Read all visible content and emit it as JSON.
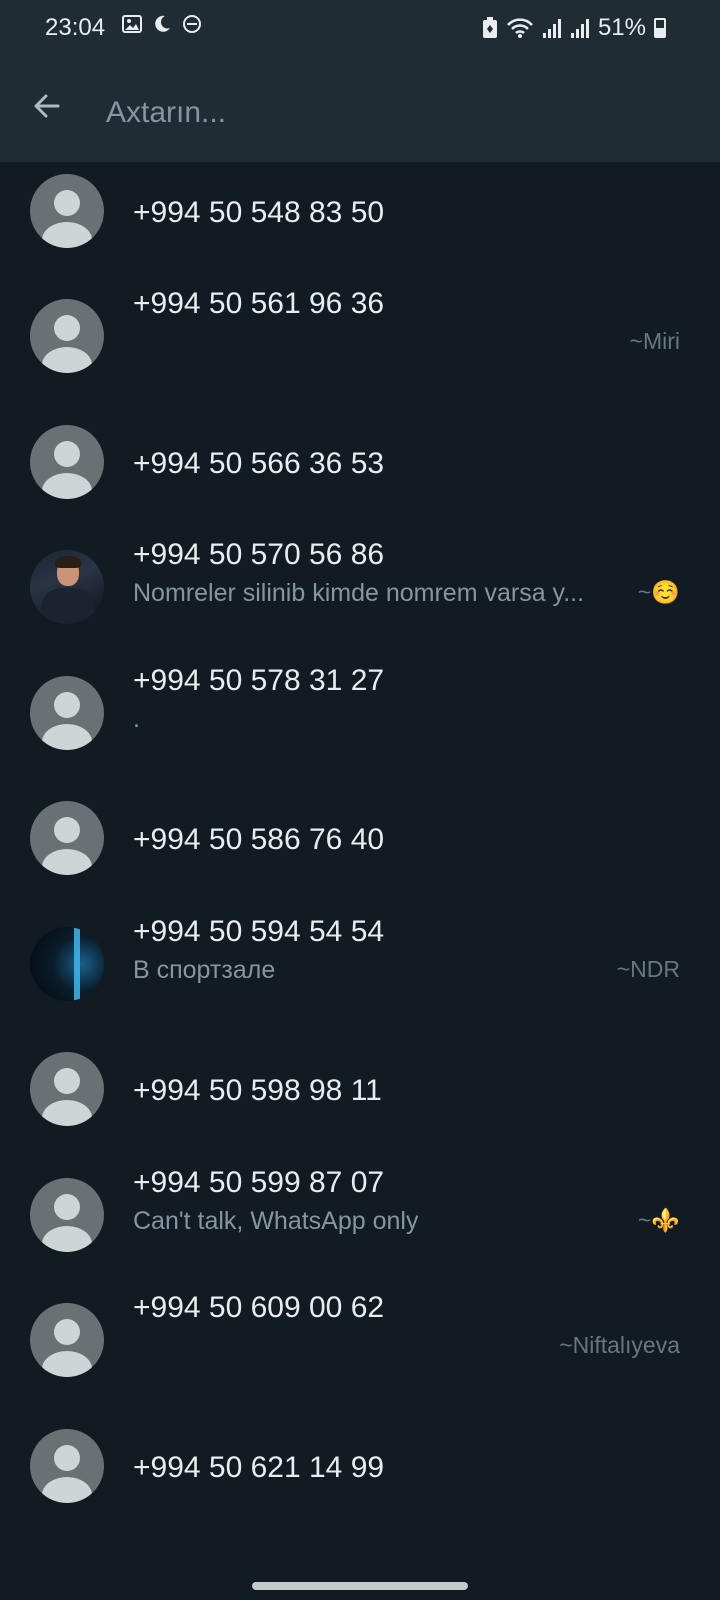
{
  "status_bar": {
    "time": "23:04",
    "left_icons": [
      "image-icon",
      "moon-icon",
      "dnd-icon"
    ],
    "right_icons": [
      "battery-saver-icon",
      "wifi-icon",
      "signal-icon",
      "signal-icon"
    ],
    "battery_percent": "51%",
    "battery_level": 0.51
  },
  "search": {
    "placeholder": "Axtarın..."
  },
  "contacts": [
    {
      "name": "+994 50 548 83 50",
      "status": "",
      "pushname": "",
      "avatar": "default"
    },
    {
      "name": "+994 50 561 96 36",
      "status": "",
      "pushname": "~Miri",
      "avatar": "default"
    },
    {
      "name": "+994 50 566 36 53",
      "status": "",
      "pushname": "",
      "avatar": "default"
    },
    {
      "name": "+994 50 570 56 86",
      "status": "Nomreler silinib kimde nomrem varsa y...",
      "pushname": "~☺️",
      "avatar": "photo"
    },
    {
      "name": "+994 50 578 31 27",
      "status": ".",
      "pushname": "",
      "avatar": "default"
    },
    {
      "name": "+994 50 586 76 40",
      "status": "",
      "pushname": "",
      "avatar": "default"
    },
    {
      "name": "+994 50 594 54 54",
      "status": "В спортзале",
      "pushname": "~NDR",
      "avatar": "photo-dark"
    },
    {
      "name": "+994 50 598 98 11",
      "status": "",
      "pushname": "",
      "avatar": "default"
    },
    {
      "name": "+994 50 599 87 07",
      "status": "Can't talk, WhatsApp only",
      "pushname": "~⚜️",
      "avatar": "default"
    },
    {
      "name": "+994 50 609 00 62",
      "status": "",
      "pushname": "~Niftalıyeva",
      "avatar": "default"
    },
    {
      "name": "+994 50 621 14 99",
      "status": "",
      "pushname": "",
      "avatar": "default"
    }
  ]
}
